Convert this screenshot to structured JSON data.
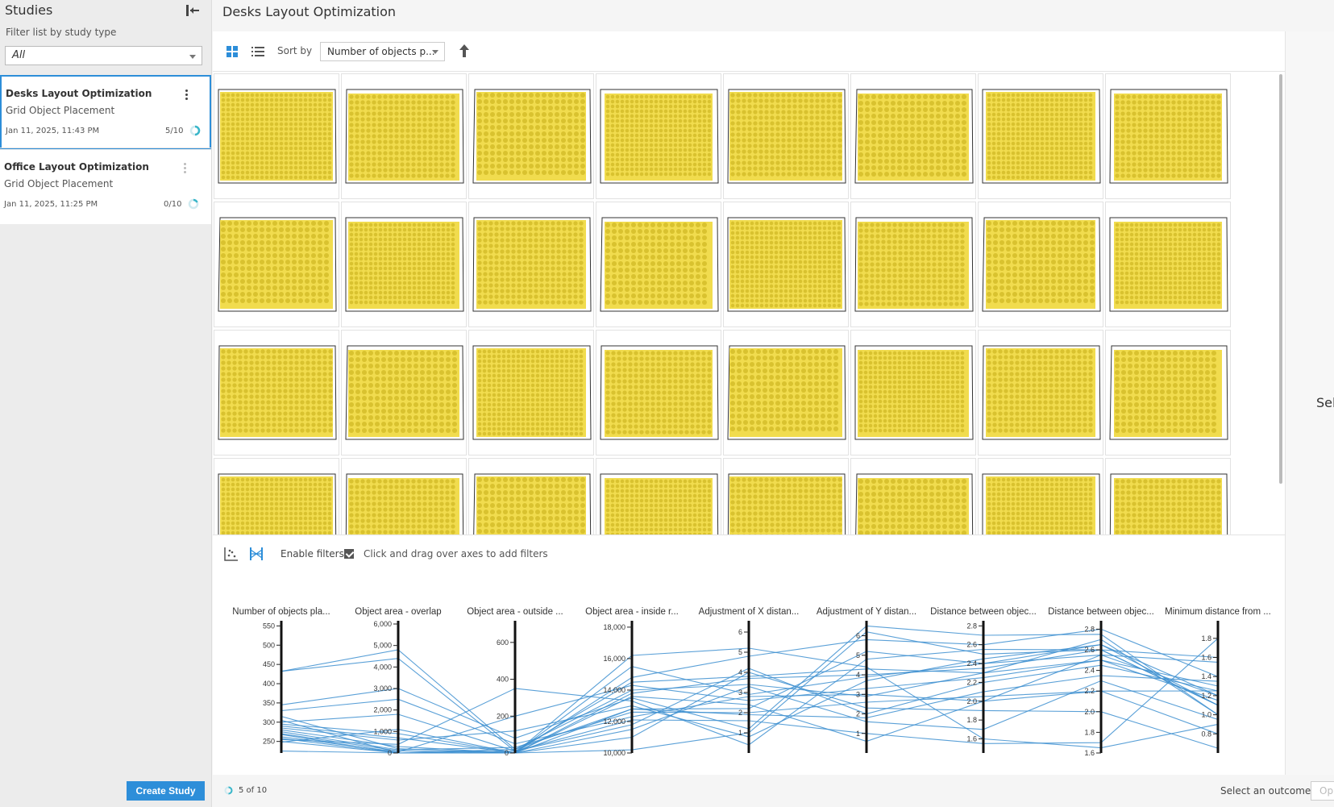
{
  "sidebar": {
    "title": "Studies",
    "filter_label": "Filter list by study type",
    "filter_value": "All",
    "studies": [
      {
        "title": "Desks Layout Optimization",
        "type": "Grid Object Placement",
        "date": "Jan 11, 2025, 11:43 PM",
        "progress": "5/10",
        "progress_fraction": 0.5,
        "active": true
      },
      {
        "title": "Office Layout Optimization",
        "type": "Grid Object Placement",
        "date": "Jan 11, 2025, 11:25 PM",
        "progress": "0/10",
        "progress_fraction": 0.0,
        "active": false
      }
    ],
    "create_button": "Create Study"
  },
  "main": {
    "title": "Desks Layout Optimization",
    "toolbar": {
      "sort_label": "Sort by",
      "sort_value": "Number of objects p..."
    },
    "thumbnails": {
      "count_visible": 32,
      "fill_color": "#f1dc4e",
      "dot_color": "#d9c22f"
    }
  },
  "filters": {
    "enable_label": "Enable filters",
    "enabled": true,
    "hint": "Click and drag over axes to add filters"
  },
  "parallel": {
    "line_color": "#3d8fd0",
    "axes": [
      {
        "label": "Number of objects pla...",
        "ticks": [
          "550",
          "500",
          "450",
          "400",
          "350",
          "300",
          "250"
        ],
        "min": 220,
        "max": 555
      },
      {
        "label": "Object area - overlap",
        "ticks": [
          "6,000",
          "5,000",
          "4,000",
          "3,000",
          "2,000",
          "1,000",
          "0"
        ],
        "min": 0,
        "max": 6000
      },
      {
        "label": "Object area - outside ...",
        "ticks": [
          "600",
          "400",
          "200",
          "0"
        ],
        "min": 0,
        "max": 700
      },
      {
        "label": "Object area - inside r...",
        "ticks": [
          "18,000",
          "16,000",
          "14,000",
          "12,000",
          "10,000"
        ],
        "min": 10000,
        "max": 18200
      },
      {
        "label": "Adjustment of X distan...",
        "ticks": [
          "6",
          "5",
          "4",
          "3",
          "2",
          "1"
        ],
        "min": 0,
        "max": 6.4
      },
      {
        "label": "Adjustment of Y distan...",
        "ticks": [
          "6",
          "5",
          "4",
          "3",
          "2",
          "1"
        ],
        "min": 0,
        "max": 6.6
      },
      {
        "label": "Distance between objec...",
        "ticks": [
          "2.8",
          "2.6",
          "2.4",
          "2.2",
          "2.0",
          "1.8",
          "1.6"
        ],
        "min": 1.45,
        "max": 2.82
      },
      {
        "label": "Distance between objec...",
        "ticks": [
          "2.8",
          "2.6",
          "2.4",
          "2.2",
          "2.0",
          "1.8",
          "1.6"
        ],
        "min": 1.6,
        "max": 2.85
      },
      {
        "label": "Minimum distance from ...",
        "ticks": [
          "1.8",
          "1.6",
          "1.4",
          "1.2",
          "1.0",
          "0.8"
        ],
        "min": 0.6,
        "max": 1.95
      }
    ],
    "lines": [
      [
        432,
        4800,
        20,
        12800,
        2.2,
        5.2,
        2.4,
        2.65,
        1.1
      ],
      [
        432,
        4400,
        10,
        14500,
        3.8,
        4.3,
        2.3,
        2.5,
        1.3
      ],
      [
        345,
        3000,
        80,
        13500,
        1.2,
        6.5,
        2.7,
        2.75,
        1.0
      ],
      [
        330,
        2500,
        50,
        12300,
        2.8,
        3.0,
        2.0,
        2.55,
        1.55
      ],
      [
        300,
        1800,
        10,
        11800,
        4.2,
        2.0,
        2.2,
        2.45,
        1.25
      ],
      [
        295,
        900,
        0,
        11500,
        3.3,
        1.6,
        1.7,
        2.3,
        0.95
      ],
      [
        285,
        600,
        120,
        13000,
        0.8,
        3.7,
        2.45,
        2.65,
        1.2
      ],
      [
        280,
        300,
        0,
        14800,
        4.8,
        5.8,
        2.6,
        2.8,
        1.4
      ],
      [
        275,
        150,
        30,
        12600,
        2.0,
        2.6,
        2.05,
        2.2,
        0.8
      ],
      [
        270,
        100,
        0,
        13800,
        3.7,
        4.0,
        2.35,
        2.6,
        1.1
      ],
      [
        268,
        0,
        10,
        12100,
        1.6,
        1.0,
        1.55,
        1.7,
        1.8
      ],
      [
        262,
        50,
        200,
        14300,
        2.6,
        3.3,
        2.25,
        2.5,
        1.15
      ],
      [
        258,
        0,
        0,
        11000,
        4.0,
        2.3,
        1.9,
        2.0,
        0.65
      ],
      [
        255,
        400,
        350,
        13300,
        0.4,
        4.8,
        2.55,
        2.6,
        1.6
      ],
      [
        250,
        0,
        0,
        15500,
        2.9,
        3.9,
        2.4,
        2.55,
        1.2
      ],
      [
        248,
        1100,
        0,
        12800,
        1.9,
        1.8,
        2.1,
        2.35,
        1.35
      ],
      [
        305,
        0,
        20,
        14000,
        3.4,
        2.9,
        2.3,
        2.7,
        1.0
      ],
      [
        315,
        200,
        0,
        10200,
        1.0,
        6.2,
        2.5,
        2.6,
        1.1
      ],
      [
        290,
        700,
        0,
        16200,
        5.2,
        4.4,
        1.6,
        1.65,
        0.9
      ],
      [
        225,
        0,
        0,
        13600,
        2.4,
        0.6,
        2.0,
        2.2,
        1.25
      ]
    ]
  },
  "status": {
    "count": "5 of 10",
    "outcome_label": "Select an outcome",
    "outcome_button": "Op"
  },
  "right_panel": {
    "select_text": "Sel"
  }
}
